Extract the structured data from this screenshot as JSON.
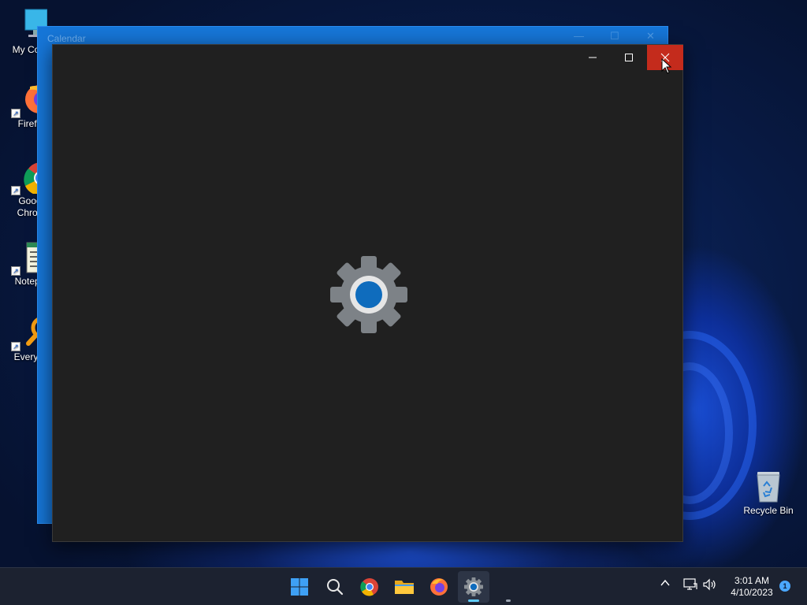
{
  "desktop": {
    "icons": [
      {
        "label": "My Com",
        "icon": "computer-icon"
      },
      {
        "label": "Firefo",
        "icon": "firefox-icon"
      },
      {
        "label": "Goog\nChron",
        "icon": "chrome-icon"
      },
      {
        "label": "Notepa",
        "icon": "notepad-icon"
      },
      {
        "label": "Everyth",
        "icon": "everything-icon"
      }
    ],
    "recycle_bin": {
      "label": "Recycle Bin",
      "icon": "recycle-bin-icon"
    }
  },
  "calendar_window": {
    "title": "Calendar"
  },
  "settings_window": {
    "splash_icon": "settings-gear-icon",
    "accent": "#0f6cbd",
    "close_hover_color": "#c42b1c"
  },
  "taskbar": {
    "items": [
      {
        "name": "start",
        "icon": "windows-start-icon"
      },
      {
        "name": "search",
        "icon": "search-icon"
      },
      {
        "name": "chrome",
        "icon": "chrome-icon"
      },
      {
        "name": "file-explorer",
        "icon": "folder-icon"
      },
      {
        "name": "firefox",
        "icon": "firefox-icon"
      },
      {
        "name": "settings",
        "icon": "settings-gear-icon",
        "active": true
      }
    ],
    "tray": {
      "time": "3:01 AM",
      "date": "4/10/2023",
      "notification_count": "1"
    }
  }
}
